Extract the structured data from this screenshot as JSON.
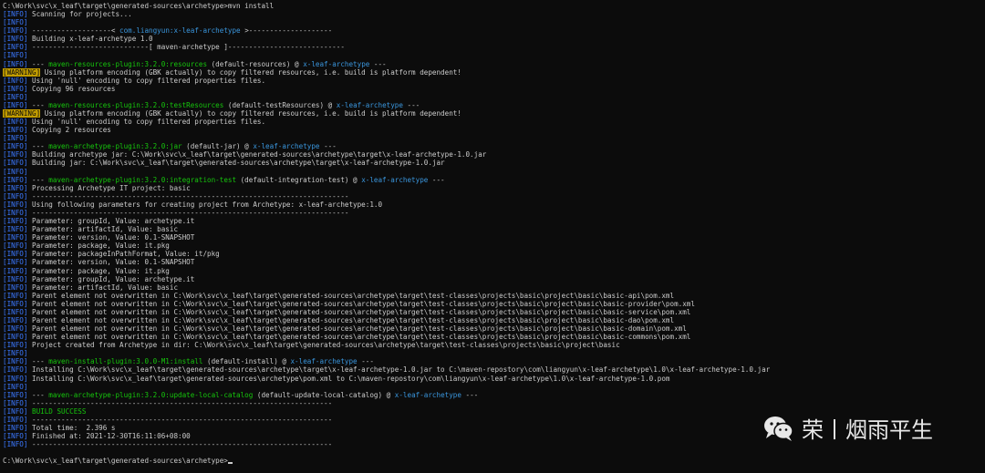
{
  "terminal": {
    "lines": [
      [
        {
          "t": "C:\\Work\\svc\\x_leaf\\target\\generated-sources\\archetype>mvn install",
          "c": ""
        }
      ],
      [
        {
          "t": "[INFO]",
          "c": "info"
        },
        {
          "t": " Scanning for projects...",
          "c": ""
        }
      ],
      [
        {
          "t": "[INFO]",
          "c": "info"
        }
      ],
      [
        {
          "t": "[INFO]",
          "c": "info"
        },
        {
          "t": " -------------------< ",
          "c": ""
        },
        {
          "t": "com.liangyun:x-leaf-archetype",
          "c": "cyan"
        },
        {
          "t": " >--------------------",
          "c": ""
        }
      ],
      [
        {
          "t": "[INFO]",
          "c": "info"
        },
        {
          "t": " Building x-leaf-archetype 1.0",
          "c": ""
        }
      ],
      [
        {
          "t": "[INFO]",
          "c": "info"
        },
        {
          "t": " ----------------------------[ maven-archetype ]----------------------------",
          "c": ""
        }
      ],
      [
        {
          "t": "[INFO]",
          "c": "info"
        }
      ],
      [
        {
          "t": "[INFO]",
          "c": "info"
        },
        {
          "t": " --- ",
          "c": ""
        },
        {
          "t": "maven-resources-plugin:3.2.0:resources",
          "c": "green"
        },
        {
          "t": " (default-resources) @ ",
          "c": ""
        },
        {
          "t": "x-leaf-archetype",
          "c": "cyan"
        },
        {
          "t": " ---",
          "c": ""
        }
      ],
      [
        {
          "t": "[WARNING]",
          "c": "warn"
        },
        {
          "t": " Using platform encoding (GBK actually) to copy filtered resources, i.e. build is platform dependent!",
          "c": ""
        }
      ],
      [
        {
          "t": "[INFO]",
          "c": "info"
        },
        {
          "t": " Using 'null' encoding to copy filtered properties files.",
          "c": ""
        }
      ],
      [
        {
          "t": "[INFO]",
          "c": "info"
        },
        {
          "t": " Copying 96 resources",
          "c": ""
        }
      ],
      [
        {
          "t": "[INFO]",
          "c": "info"
        }
      ],
      [
        {
          "t": "[INFO]",
          "c": "info"
        },
        {
          "t": " --- ",
          "c": ""
        },
        {
          "t": "maven-resources-plugin:3.2.0:testResources",
          "c": "green"
        },
        {
          "t": " (default-testResources) @ ",
          "c": ""
        },
        {
          "t": "x-leaf-archetype",
          "c": "cyan"
        },
        {
          "t": " ---",
          "c": ""
        }
      ],
      [
        {
          "t": "[WARNING]",
          "c": "warn"
        },
        {
          "t": " Using platform encoding (GBK actually) to copy filtered resources, i.e. build is platform dependent!",
          "c": ""
        }
      ],
      [
        {
          "t": "[INFO]",
          "c": "info"
        },
        {
          "t": " Using 'null' encoding to copy filtered properties files.",
          "c": ""
        }
      ],
      [
        {
          "t": "[INFO]",
          "c": "info"
        },
        {
          "t": " Copying 2 resources",
          "c": ""
        }
      ],
      [
        {
          "t": "[INFO]",
          "c": "info"
        }
      ],
      [
        {
          "t": "[INFO]",
          "c": "info"
        },
        {
          "t": " --- ",
          "c": ""
        },
        {
          "t": "maven-archetype-plugin:3.2.0:jar",
          "c": "green"
        },
        {
          "t": " (default-jar) @ ",
          "c": ""
        },
        {
          "t": "x-leaf-archetype",
          "c": "cyan"
        },
        {
          "t": " ---",
          "c": ""
        }
      ],
      [
        {
          "t": "[INFO]",
          "c": "info"
        },
        {
          "t": " Building archetype jar: C:\\Work\\svc\\x_leaf\\target\\generated-sources\\archetype\\target\\x-leaf-archetype-1.0.jar",
          "c": ""
        }
      ],
      [
        {
          "t": "[INFO]",
          "c": "info"
        },
        {
          "t": " Building jar: C:\\Work\\svc\\x_leaf\\target\\generated-sources\\archetype\\target\\x-leaf-archetype-1.0.jar",
          "c": ""
        }
      ],
      [
        {
          "t": "[INFO]",
          "c": "info"
        }
      ],
      [
        {
          "t": "[INFO]",
          "c": "info"
        },
        {
          "t": " --- ",
          "c": ""
        },
        {
          "t": "maven-archetype-plugin:3.2.0:integration-test",
          "c": "green"
        },
        {
          "t": " (default-integration-test) @ ",
          "c": ""
        },
        {
          "t": "x-leaf-archetype",
          "c": "cyan"
        },
        {
          "t": " ---",
          "c": ""
        }
      ],
      [
        {
          "t": "[INFO]",
          "c": "info"
        },
        {
          "t": " Processing Archetype IT project: basic",
          "c": ""
        }
      ],
      [
        {
          "t": "[INFO]",
          "c": "info"
        },
        {
          "t": " ----------------------------------------------------------------------------",
          "c": ""
        }
      ],
      [
        {
          "t": "[INFO]",
          "c": "info"
        },
        {
          "t": " Using following parameters for creating project from Archetype: x-leaf-archetype:1.0",
          "c": ""
        }
      ],
      [
        {
          "t": "[INFO]",
          "c": "info"
        },
        {
          "t": " ----------------------------------------------------------------------------",
          "c": ""
        }
      ],
      [
        {
          "t": "[INFO]",
          "c": "info"
        },
        {
          "t": " Parameter: groupId, Value: archetype.it",
          "c": ""
        }
      ],
      [
        {
          "t": "[INFO]",
          "c": "info"
        },
        {
          "t": " Parameter: artifactId, Value: basic",
          "c": ""
        }
      ],
      [
        {
          "t": "[INFO]",
          "c": "info"
        },
        {
          "t": " Parameter: version, Value: 0.1-SNAPSHOT",
          "c": ""
        }
      ],
      [
        {
          "t": "[INFO]",
          "c": "info"
        },
        {
          "t": " Parameter: package, Value: it.pkg",
          "c": ""
        }
      ],
      [
        {
          "t": "[INFO]",
          "c": "info"
        },
        {
          "t": " Parameter: packageInPathFormat, Value: it/pkg",
          "c": ""
        }
      ],
      [
        {
          "t": "[INFO]",
          "c": "info"
        },
        {
          "t": " Parameter: version, Value: 0.1-SNAPSHOT",
          "c": ""
        }
      ],
      [
        {
          "t": "[INFO]",
          "c": "info"
        },
        {
          "t": " Parameter: package, Value: it.pkg",
          "c": ""
        }
      ],
      [
        {
          "t": "[INFO]",
          "c": "info"
        },
        {
          "t": " Parameter: groupId, Value: archetype.it",
          "c": ""
        }
      ],
      [
        {
          "t": "[INFO]",
          "c": "info"
        },
        {
          "t": " Parameter: artifactId, Value: basic",
          "c": ""
        }
      ],
      [
        {
          "t": "[INFO]",
          "c": "info"
        },
        {
          "t": " Parent element not overwritten in C:\\Work\\svc\\x_leaf\\target\\generated-sources\\archetype\\target\\test-classes\\projects\\basic\\project\\basic\\basic-api\\pom.xml",
          "c": ""
        }
      ],
      [
        {
          "t": "[INFO]",
          "c": "info"
        },
        {
          "t": " Parent element not overwritten in C:\\Work\\svc\\x_leaf\\target\\generated-sources\\archetype\\target\\test-classes\\projects\\basic\\project\\basic\\basic-provider\\pom.xml",
          "c": ""
        }
      ],
      [
        {
          "t": "[INFO]",
          "c": "info"
        },
        {
          "t": " Parent element not overwritten in C:\\Work\\svc\\x_leaf\\target\\generated-sources\\archetype\\target\\test-classes\\projects\\basic\\project\\basic\\basic-service\\pom.xml",
          "c": ""
        }
      ],
      [
        {
          "t": "[INFO]",
          "c": "info"
        },
        {
          "t": " Parent element not overwritten in C:\\Work\\svc\\x_leaf\\target\\generated-sources\\archetype\\target\\test-classes\\projects\\basic\\project\\basic\\basic-dao\\pom.xml",
          "c": ""
        }
      ],
      [
        {
          "t": "[INFO]",
          "c": "info"
        },
        {
          "t": " Parent element not overwritten in C:\\Work\\svc\\x_leaf\\target\\generated-sources\\archetype\\target\\test-classes\\projects\\basic\\project\\basic\\basic-domain\\pom.xml",
          "c": ""
        }
      ],
      [
        {
          "t": "[INFO]",
          "c": "info"
        },
        {
          "t": " Parent element not overwritten in C:\\Work\\svc\\x_leaf\\target\\generated-sources\\archetype\\target\\test-classes\\projects\\basic\\project\\basic\\basic-commons\\pom.xml",
          "c": ""
        }
      ],
      [
        {
          "t": "[INFO]",
          "c": "info"
        },
        {
          "t": " Project created from Archetype in dir: C:\\Work\\svc\\x_leaf\\target\\generated-sources\\archetype\\target\\test-classes\\projects\\basic\\project\\basic",
          "c": ""
        }
      ],
      [
        {
          "t": "[INFO]",
          "c": "info"
        }
      ],
      [
        {
          "t": "[INFO]",
          "c": "info"
        },
        {
          "t": " --- ",
          "c": ""
        },
        {
          "t": "maven-install-plugin:3.0.0-M1:install",
          "c": "green"
        },
        {
          "t": " (default-install) @ ",
          "c": ""
        },
        {
          "t": "x-leaf-archetype",
          "c": "cyan"
        },
        {
          "t": " ---",
          "c": ""
        }
      ],
      [
        {
          "t": "[INFO]",
          "c": "info"
        },
        {
          "t": " Installing C:\\Work\\svc\\x_leaf\\target\\generated-sources\\archetype\\target\\x-leaf-archetype-1.0.jar to C:\\maven-repostory\\com\\liangyun\\x-leaf-archetype\\1.0\\x-leaf-archetype-1.0.jar",
          "c": ""
        }
      ],
      [
        {
          "t": "[INFO]",
          "c": "info"
        },
        {
          "t": " Installing C:\\Work\\svc\\x_leaf\\target\\generated-sources\\archetype\\pom.xml to C:\\maven-repostory\\com\\liangyun\\x-leaf-archetype\\1.0\\x-leaf-archetype-1.0.pom",
          "c": ""
        }
      ],
      [
        {
          "t": "[INFO]",
          "c": "info"
        }
      ],
      [
        {
          "t": "[INFO]",
          "c": "info"
        },
        {
          "t": " --- ",
          "c": ""
        },
        {
          "t": "maven-archetype-plugin:3.2.0:update-local-catalog",
          "c": "green"
        },
        {
          "t": " (default-update-local-catalog) @ ",
          "c": ""
        },
        {
          "t": "x-leaf-archetype",
          "c": "cyan"
        },
        {
          "t": " ---",
          "c": ""
        }
      ],
      [
        {
          "t": "[INFO]",
          "c": "info"
        },
        {
          "t": " ------------------------------------------------------------------------",
          "c": ""
        }
      ],
      [
        {
          "t": "[INFO]",
          "c": "info"
        },
        {
          "t": " BUILD SUCCESS",
          "c": "green"
        }
      ],
      [
        {
          "t": "[INFO]",
          "c": "info"
        },
        {
          "t": " ------------------------------------------------------------------------",
          "c": ""
        }
      ],
      [
        {
          "t": "[INFO]",
          "c": "info"
        },
        {
          "t": " Total time:  2.396 s",
          "c": ""
        }
      ],
      [
        {
          "t": "[INFO]",
          "c": "info"
        },
        {
          "t": " Finished at: 2021-12-30T16:11:06+08:00",
          "c": ""
        }
      ],
      [
        {
          "t": "[INFO]",
          "c": "info"
        },
        {
          "t": " ------------------------------------------------------------------------",
          "c": ""
        }
      ],
      [
        {
          "t": "",
          "c": ""
        }
      ],
      [
        {
          "t": "C:\\Work\\svc\\x_leaf\\target\\generated-sources\\archetype>",
          "c": ""
        }
      ]
    ]
  },
  "watermark": {
    "text": "荣丨烟雨平生",
    "icon": "wechat-icon"
  },
  "colors": {
    "background": "#0c0c0c",
    "text": "#cccccc",
    "info": "#3b78ff",
    "warning_bg": "#c19c00",
    "green": "#16c60c",
    "cyan": "#3a96dd"
  }
}
